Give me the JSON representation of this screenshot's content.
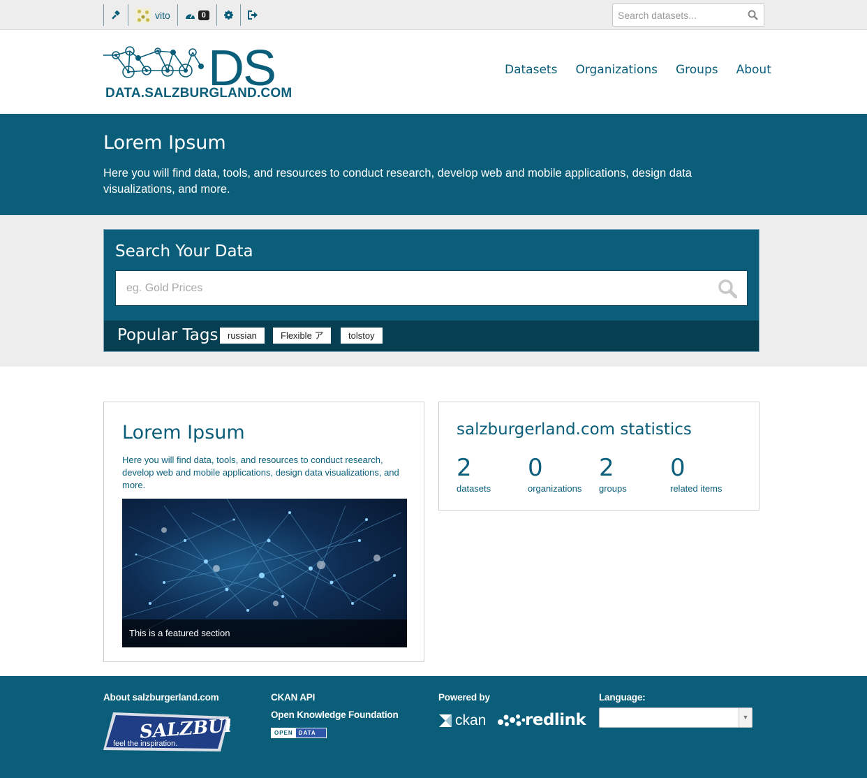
{
  "account": {
    "admin_icon": "gavel-icon",
    "username": "vito",
    "dashboard_icon": "dashboard-icon",
    "notifications": "0",
    "settings_icon": "gear-icon",
    "logout_icon": "sign-out-icon",
    "search_placeholder": "Search datasets..."
  },
  "header": {
    "logo_mark": "DS",
    "logo_text": "DATA.SALZBURGLAND.COM",
    "nav": [
      "Datasets",
      "Organizations",
      "Groups",
      "About"
    ]
  },
  "hero": {
    "title": "Lorem Ipsum",
    "text": "Here you will find data, tools, and resources to conduct research, develop web and mobile applications, design data visualizations, and more."
  },
  "search": {
    "title": "Search Your Data",
    "placeholder": "eg. Gold Prices",
    "tags_title": "Popular Tags",
    "tags": [
      "russian",
      "Flexible ア",
      "tolstoy"
    ]
  },
  "featured": {
    "title": "Lorem Ipsum",
    "text": "Here you will find data, tools, and resources to conduct research, develop web and mobile applications, design data visualizations, and more.",
    "caption": "This is a featured section"
  },
  "stats": {
    "title": "salzburgerland.com statistics",
    "items": [
      {
        "value": "2",
        "label": "datasets"
      },
      {
        "value": "0",
        "label": "organizations"
      },
      {
        "value": "2",
        "label": "groups"
      },
      {
        "value": "0",
        "label": "related items"
      }
    ]
  },
  "footer": {
    "about": "About salzburgerland.com",
    "salzburg_logo": "SALZBURG",
    "salzburg_tagline": "feel the inspiration.",
    "ckan_api": "CKAN API",
    "okf": "Open Knowledge Foundation",
    "open_data_a": "OPEN",
    "open_data_b": "DATA",
    "powered_by": "Powered by",
    "ckan": "ckan",
    "redlink": "redlink",
    "language_label": "Language:",
    "language_value": ""
  },
  "colors": {
    "brand": "#0b5e7a",
    "brand_dark": "#063f52",
    "bar": "#ededed"
  }
}
